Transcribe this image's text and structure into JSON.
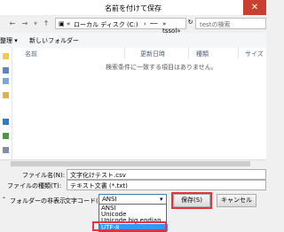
{
  "window": {
    "title": "名前を付けて保存",
    "close": "✕"
  },
  "nav": {
    "back": "←",
    "forward": "→",
    "up": "↑",
    "path_prefix": "«",
    "path_drive": "ローカル ディスク (C:)",
    "path_sep": "›",
    "path_user": "──",
    "path_last": "» tssol»",
    "search_placeholder": "testの検索",
    "search_icon": "search-icon"
  },
  "toolbar": {
    "organize": "整理 ▾",
    "new_folder": "新しいフォルダー"
  },
  "table": {
    "col_name": "名前",
    "col_date": "更新日時",
    "col_type": "種類",
    "col_size": "サイズ",
    "empty": "検索条件に一致する項目はありません。"
  },
  "form": {
    "filename_label": "ファイル名(N):",
    "filename_value": "文字化けテスト.csv",
    "filetype_label": "ファイルの種類(T):",
    "filetype_value": "テキスト文書 (*.txt)",
    "hide_folders": "フォルダーの非表示",
    "encoding_label": "文字コード(E):",
    "encoding_value": "ANSI",
    "save": "保存(S)",
    "cancel": "キャンセル"
  },
  "encoding_options": [
    "ANSI",
    "Unicode",
    "Unicode big endian",
    "UTF-8"
  ]
}
